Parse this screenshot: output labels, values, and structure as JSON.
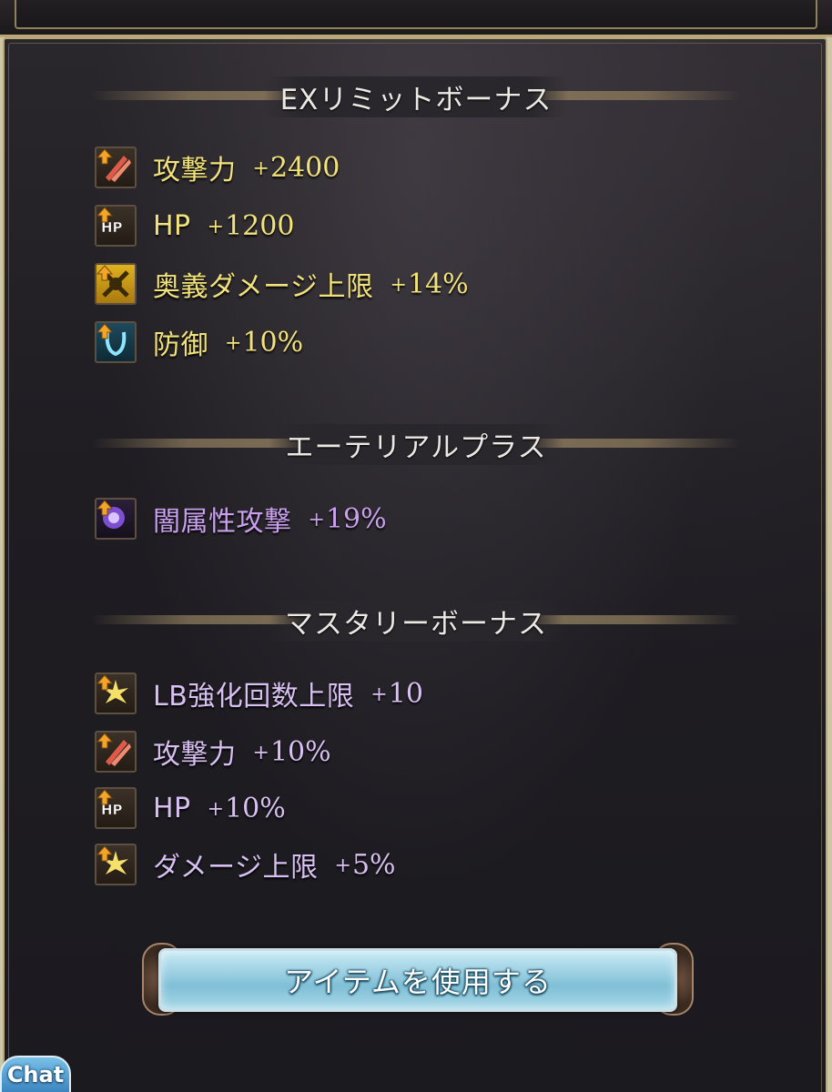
{
  "colors": {
    "yellow_text": "#f2e27a",
    "purple_text": "#c9a0ee",
    "lilac_text": "#d8c0f2",
    "panel_bg": "#222024",
    "button_blue": "#9fd2e4"
  },
  "sections": {
    "ex_limit": {
      "title": "EXリミットボーナス",
      "items": [
        {
          "icon": "attack-sword-icon",
          "label": "攻撃力",
          "sign": "+",
          "value": "2400"
        },
        {
          "icon": "hp-icon",
          "label": "HP",
          "sign": "+",
          "value": "1200"
        },
        {
          "icon": "ougi-damage-cap-icon",
          "label": "奥義ダメージ上限",
          "sign": "+",
          "value": "14%"
        },
        {
          "icon": "defense-shield-icon",
          "label": "防御",
          "sign": "+",
          "value": "10%"
        }
      ]
    },
    "ethereal": {
      "title": "エーテリアルプラス",
      "items": [
        {
          "icon": "dark-element-icon",
          "label": "闇属性攻撃",
          "sign": "+",
          "value": "19%"
        }
      ]
    },
    "mastery": {
      "title": "マスタリーボーナス",
      "items": [
        {
          "icon": "star-burst-icon",
          "label": "LB強化回数上限",
          "sign": "+",
          "value": "10"
        },
        {
          "icon": "attack-sword-icon",
          "label": "攻撃力",
          "sign": "+",
          "value": "10%"
        },
        {
          "icon": "hp-icon",
          "label": "HP",
          "sign": "+",
          "value": "10%"
        },
        {
          "icon": "star-burst-icon",
          "label": "ダメージ上限",
          "sign": "+",
          "value": "5%"
        }
      ]
    }
  },
  "use_item_button": {
    "label": "アイテムを使用する"
  },
  "chat": {
    "label": "Chat"
  }
}
